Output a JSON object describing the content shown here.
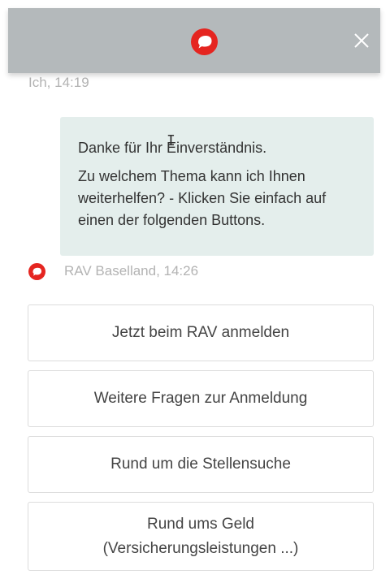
{
  "header": {
    "logo_icon": "speech-bubble-logo",
    "close_icon": "close-x"
  },
  "user_meta": "Ich, 14:19",
  "bot_message": {
    "line1": "Danke für Ihr Einverständnis.",
    "line2": "Zu welchem Thema kann ich Ihnen weiterhelfen? - Klicken Sie einfach auf einen der folgenden Buttons."
  },
  "bot_meta": "RAV Baselland, 14:26",
  "buttons": [
    {
      "label": "Jetzt beim RAV anmelden"
    },
    {
      "label": "Weitere Fragen zur Anmeldung"
    },
    {
      "label": "Rund um die Stellensuche"
    },
    {
      "label_line1": "Rund ums Geld",
      "label_line2": "(Versicherungsleistungen ...)"
    }
  ],
  "colors": {
    "header": "#b4b9bb",
    "brand_red": "#e52520",
    "bubble": "#e4eeec",
    "meta_text": "#b3b3b3"
  }
}
